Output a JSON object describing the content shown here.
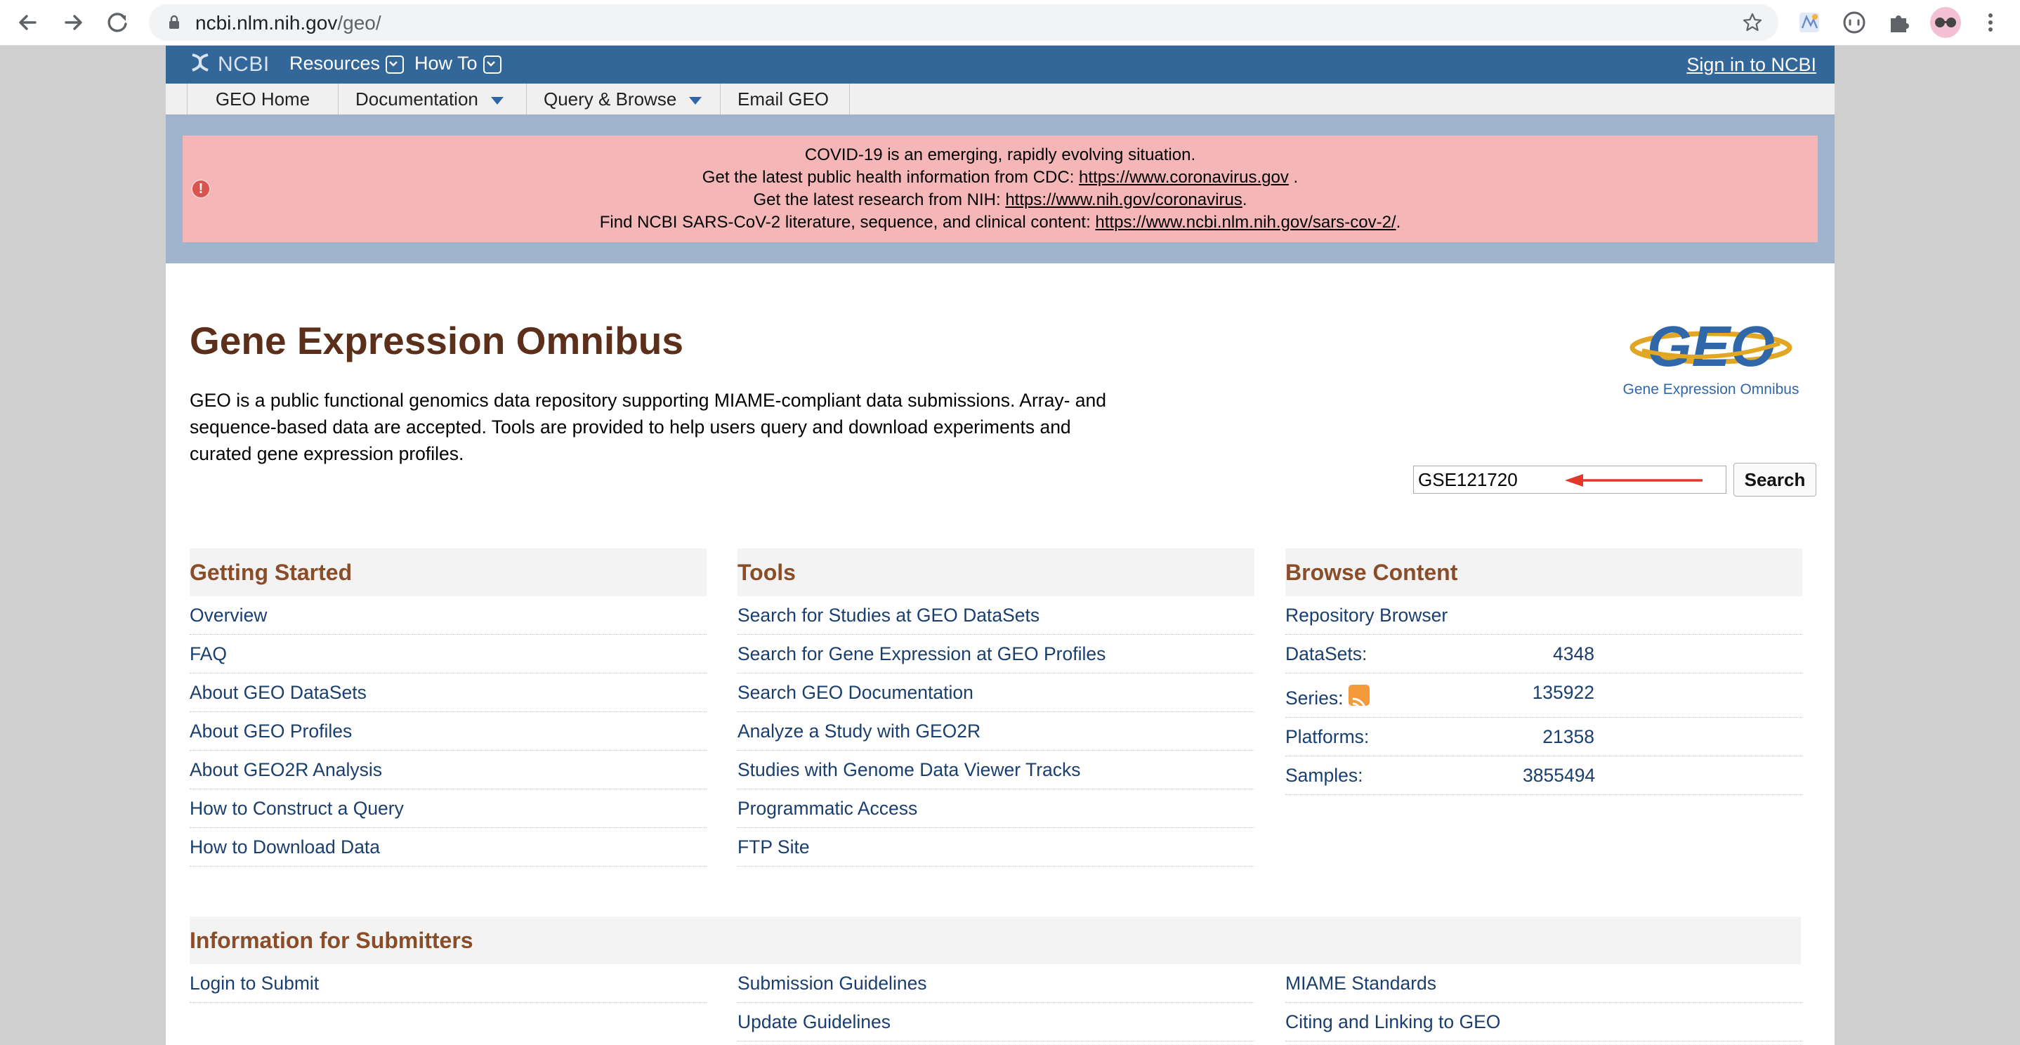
{
  "browser": {
    "url_host": "ncbi.nlm.nih.gov",
    "url_path": "/geo/"
  },
  "ncbi_bar": {
    "logo_text": "NCBI",
    "menus": [
      "Resources",
      "How To"
    ],
    "sign_in": "Sign in to NCBI"
  },
  "geo_nav": {
    "items": [
      "GEO Home",
      "Documentation",
      "Query & Browse",
      "Email GEO"
    ]
  },
  "alert": {
    "line1": "COVID-19 is an emerging, rapidly evolving situation.",
    "line2_prefix": "Get the latest public health information from CDC: ",
    "line2_link": "https://www.coronavirus.gov",
    "line2_suffix": " .",
    "line3_prefix": "Get the latest research from NIH: ",
    "line3_link": "https://www.nih.gov/coronavirus",
    "line3_suffix": ".",
    "line4_prefix": "Find NCBI SARS-CoV-2 literature, sequence, and clinical content: ",
    "line4_link": "https://www.ncbi.nlm.nih.gov/sars-cov-2/",
    "line4_suffix": ".",
    "icon": "exclamation-icon"
  },
  "header": {
    "title": "Gene Expression Omnibus",
    "intro": "GEO is a public functional genomics data repository supporting MIAME-compliant data submissions. Array- and sequence-based data are accepted. Tools are provided to help users query and download experiments and curated gene expression profiles.",
    "logo_text": "GEO",
    "logo_subtitle": "Gene Expression Omnibus"
  },
  "search": {
    "value": "GSE121720",
    "button": "Search"
  },
  "getting_started": {
    "heading": "Getting Started",
    "items": [
      "Overview",
      "FAQ",
      "About GEO DataSets",
      "About GEO Profiles",
      "About GEO2R Analysis",
      "How to Construct a Query",
      "How to Download Data"
    ]
  },
  "tools": {
    "heading": "Tools",
    "items": [
      "Search for Studies at GEO DataSets",
      "Search for Gene Expression at GEO Profiles",
      "Search GEO Documentation",
      "Analyze a Study with GEO2R",
      "Studies with Genome Data Viewer Tracks",
      "Programmatic Access",
      "FTP Site"
    ]
  },
  "browse": {
    "heading": "Browse Content",
    "repository_browser": "Repository Browser",
    "stats": [
      {
        "label": "DataSets:",
        "value": "4348"
      },
      {
        "label": "Series:",
        "value": "135922"
      },
      {
        "label": "Platforms:",
        "value": "21358"
      },
      {
        "label": "Samples:",
        "value": "3855494"
      }
    ]
  },
  "submitters": {
    "heading": "Information for Submitters",
    "col1": [
      "Login to Submit"
    ],
    "col2": [
      "Submission Guidelines",
      "Update Guidelines"
    ],
    "col3": [
      "MIAME Standards",
      "Citing and Linking to GEO"
    ]
  }
}
